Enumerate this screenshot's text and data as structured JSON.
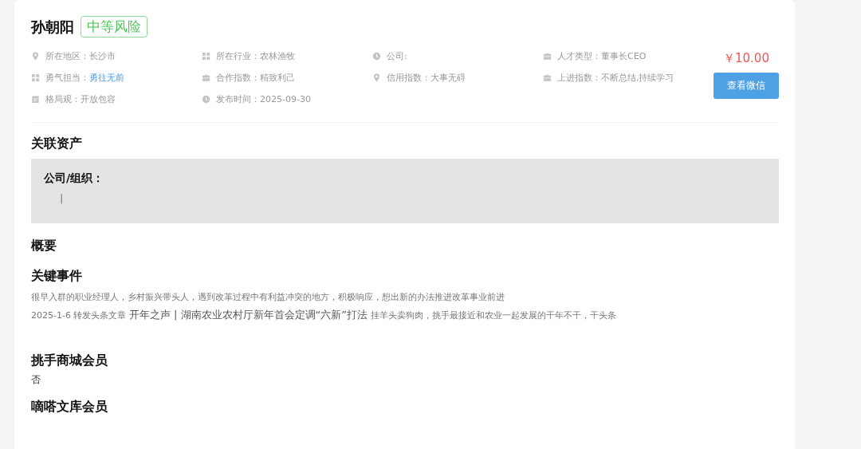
{
  "profile": {
    "name": "孙朝阳",
    "risk_tag": "中等风险"
  },
  "info": [
    {
      "kind": "pin",
      "label": "所在地区：",
      "value": "长沙市"
    },
    {
      "kind": "grid",
      "label": "所在行业：",
      "value": "农林渔牧"
    },
    {
      "kind": "clock",
      "label": "公司:"
    },
    {
      "kind": "briefcase",
      "label": "人才类型：",
      "value": "董事长CEO"
    },
    {
      "kind": "grid",
      "label": "勇气担当：",
      "value": "勇往无前",
      "link": true
    },
    {
      "kind": "briefcase",
      "label": "合作指数：",
      "value": "精致利己"
    },
    {
      "kind": "pin",
      "label": "信用指数：",
      "value": "大事无碍"
    },
    {
      "kind": "briefcase",
      "label": "上进指数：",
      "value": "不断总结,持续学习"
    },
    {
      "kind": "calendar",
      "label": "格局观：",
      "value": "开放包容"
    },
    {
      "kind": "clock",
      "label": "发布时间：",
      "value": "2025-09-30"
    }
  ],
  "price": "￥10.00",
  "wechat_button": "查看微信",
  "assets": {
    "title": "关联资产",
    "group_label": "公司/组织：",
    "marker": "|"
  },
  "summary": {
    "title": "概要"
  },
  "key_events": {
    "title": "关键事件",
    "lines": [
      [
        {
          "kind": "plain",
          "text": "很早入群的职业经理人，乡村振兴带头人，遇到改革过程中有利益冲突的地方，积极响应，想出新的办法推进改革事业前进"
        }
      ],
      [
        {
          "kind": "plain",
          "text": "2025-1-6 转发头条文章 "
        },
        {
          "kind": "headline",
          "text": "开年之声 | 湖南农业农村厅新年首会定调“六新”打法"
        },
        {
          "kind": "plain",
          "text": " 挂羊头卖狗肉，挑手最接近和农业一起发展的干年不干，干头条"
        }
      ]
    ]
  },
  "memberships": [
    {
      "title": "挑手商城会员",
      "value": "否"
    },
    {
      "title": "嘀嗒文库会员"
    }
  ]
}
